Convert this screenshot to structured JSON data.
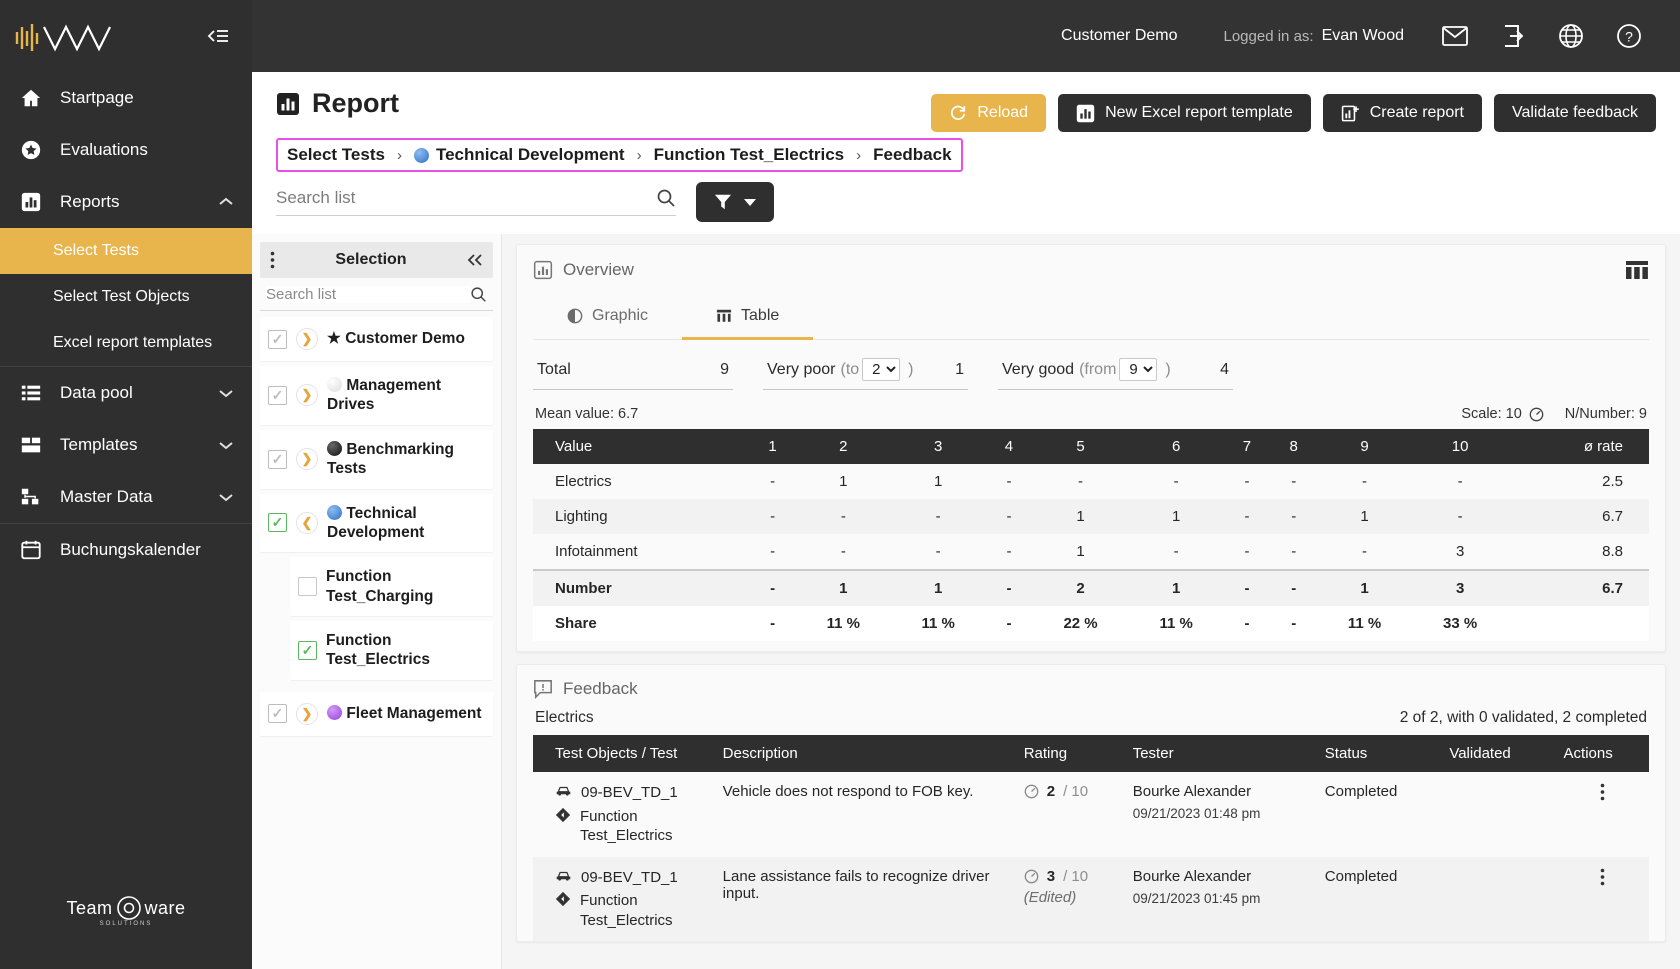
{
  "sidebar": {
    "logo_name": "teamware-wave-logo",
    "collapse_icon": "collapse-sidebar-icon",
    "items": [
      {
        "label": "Startpage",
        "icon": "home-icon",
        "chevron": ""
      },
      {
        "label": "Evaluations",
        "icon": "star-circle-icon",
        "chevron": ""
      },
      {
        "label": "Reports",
        "icon": "bar-chart-icon",
        "chevron": "chevron-up-icon"
      },
      {
        "label": "Data pool",
        "icon": "list-icon",
        "chevron": "chevron-down-icon"
      },
      {
        "label": "Templates",
        "icon": "layout-icon",
        "chevron": "chevron-down-icon"
      },
      {
        "label": "Master Data",
        "icon": "sitemap-icon",
        "chevron": "chevron-down-icon"
      },
      {
        "label": "Buchungskalender",
        "icon": "calendar-icon",
        "chevron": ""
      }
    ],
    "sub_items": [
      {
        "label": "Select Tests",
        "active": true
      },
      {
        "label": "Select Test Objects",
        "active": false
      },
      {
        "label": "Excel report templates",
        "active": false
      }
    ],
    "footer": {
      "brand_a": "Team",
      "brand_b": "ware",
      "brand_sub": "SOLUTIONS"
    }
  },
  "topbar": {
    "customer": "Customer Demo",
    "logged_label": "Logged in as:",
    "user": "Evan Wood",
    "icons": [
      "mail-icon",
      "logout-icon",
      "globe-icon",
      "help-icon"
    ]
  },
  "page": {
    "title": "Report",
    "title_icon": "report-chart-icon",
    "actions": [
      {
        "label": "Reload",
        "icon": "refresh-icon",
        "style": "amber"
      },
      {
        "label": "New Excel report template",
        "icon": "bar-chart-icon",
        "style": "dark"
      },
      {
        "label": "Create report",
        "icon": "chart-plus-icon",
        "style": "dark"
      },
      {
        "label": "Validate feedback",
        "icon": "",
        "style": "dark"
      }
    ]
  },
  "breadcrumb": {
    "items": [
      {
        "label": "Select Tests",
        "dot": ""
      },
      {
        "label": "Technical Development",
        "dot": "#3b7dd8"
      },
      {
        "label": "Function Test_Electrics",
        "dot": ""
      },
      {
        "label": "Feedback",
        "dot": ""
      }
    ],
    "separator": "›",
    "highlight_color": "#ea4fea"
  },
  "search": {
    "placeholder": "Search list",
    "value": "",
    "icon": "search-icon",
    "filter_icon": "filter-icon",
    "filter_caret": "caret-down-icon"
  },
  "selection": {
    "title": "Selection",
    "kebab_icon": "more-vertical-icon",
    "collapse_icon": "chevron-double-left-icon",
    "search_placeholder": "Search list",
    "search_value": "",
    "tree": [
      {
        "label": "Customer Demo",
        "checkbox": "indeterminate",
        "expander": "right",
        "marker": "star",
        "marker_color": "#111111",
        "child": false
      },
      {
        "label": "Management Drives",
        "checkbox": "indeterminate",
        "expander": "right",
        "marker": "dot",
        "marker_color": "#e2e2e2",
        "child": false
      },
      {
        "label": "Benchmarking Tests",
        "checkbox": "indeterminate",
        "expander": "right",
        "marker": "dot",
        "marker_color": "#1c1c1c",
        "child": false
      },
      {
        "label": "Technical Development",
        "checkbox": "checked",
        "expander": "down",
        "marker": "dot",
        "marker_color": "#3b7dd8",
        "child": false
      },
      {
        "label": "Function Test_Charging",
        "checkbox": "empty",
        "expander": "none",
        "marker": "none",
        "marker_color": "",
        "child": true
      },
      {
        "label": "Function Test_Electrics",
        "checkbox": "checked",
        "expander": "none",
        "marker": "none",
        "marker_color": "",
        "child": true
      },
      {
        "label": "Fleet Management",
        "checkbox": "indeterminate",
        "expander": "right",
        "marker": "dot",
        "marker_color": "#a855e8",
        "child": false
      }
    ]
  },
  "overview": {
    "title": "Overview",
    "title_icon": "bar-chart-icon",
    "grid_icon": "table-columns-icon",
    "tabs": [
      {
        "label": "Graphic",
        "icon": "pie-chart-icon",
        "active": false
      },
      {
        "label": "Table",
        "icon": "table-icon",
        "active": true
      }
    ],
    "stats": [
      {
        "label": "Total",
        "hint": "",
        "select": "",
        "value": "9"
      },
      {
        "label": "Very poor",
        "hint_open": "(to",
        "select": "2",
        "hint_close": ")",
        "value": "1"
      },
      {
        "label": "Very good",
        "hint_open": "(from",
        "select": "9",
        "hint_close": ")",
        "value": "4"
      }
    ],
    "mean_label": "Mean value: 6.7",
    "scale_label": "Scale: 10",
    "scale_icon": "gauge-icon",
    "nnumber_label": "N/Number: 9"
  },
  "chart_data": {
    "type": "table",
    "title": "Overview rating distribution",
    "first_col_header": "Value",
    "categories": [
      "1",
      "2",
      "3",
      "4",
      "5",
      "6",
      "7",
      "8",
      "9",
      "10"
    ],
    "last_col_header": "ø rate",
    "rows": [
      {
        "name": "Electrics",
        "values": [
          "-",
          "1",
          "1",
          "-",
          "-",
          "-",
          "-",
          "-",
          "-",
          "-"
        ],
        "avg": "2.5",
        "kind": "data"
      },
      {
        "name": "Lighting",
        "values": [
          "-",
          "-",
          "-",
          "-",
          "1",
          "1",
          "-",
          "-",
          "1",
          "-"
        ],
        "avg": "6.7",
        "kind": "data"
      },
      {
        "name": "Infotainment",
        "values": [
          "-",
          "-",
          "-",
          "-",
          "1",
          "-",
          "-",
          "-",
          "-",
          "3"
        ],
        "avg": "8.8",
        "kind": "data"
      },
      {
        "name": "Number",
        "values": [
          "-",
          "1",
          "1",
          "-",
          "2",
          "1",
          "-",
          "-",
          "1",
          "3"
        ],
        "avg": "6.7",
        "kind": "sum"
      },
      {
        "name": "Share",
        "values": [
          "-",
          "11 %",
          "11 %",
          "-",
          "22 %",
          "11 %",
          "-",
          "-",
          "11 %",
          "33 %"
        ],
        "avg": "",
        "kind": "share"
      }
    ],
    "mean_value": 6.7,
    "scale_max": 10,
    "n_number": 9,
    "total": 9,
    "very_poor_count": 1,
    "very_good_count": 4
  },
  "feedback": {
    "title": "Feedback",
    "title_icon": "comment-alert-icon",
    "group_label": "Electrics",
    "summary": "2 of 2, with 0 validated, 2 completed",
    "columns": [
      "Test Objects / Test",
      "Description",
      "Rating",
      "Tester",
      "Status",
      "Validated",
      "Actions"
    ],
    "rows": [
      {
        "object": "09-BEV_TD_1",
        "object_icon": "car-icon",
        "test": "Function Test_Electrics",
        "test_icon": "diamond-arrow-icon",
        "description": "Vehicle does not respond to FOB key.",
        "edited": "",
        "rating_icon": "gauge-icon",
        "rating_value": "2",
        "rating_scale": "/ 10",
        "tester": "Bourke Alexander",
        "tester_date": "09/21/2023 01:48 pm",
        "status": "Completed",
        "validated": "",
        "actions_icon": "more-vertical-icon"
      },
      {
        "object": "09-BEV_TD_1",
        "object_icon": "car-icon",
        "test": "Function Test_Electrics",
        "test_icon": "diamond-arrow-icon",
        "description": "Lane assistance fails to recognize driver input.",
        "edited": "(Edited)",
        "rating_icon": "gauge-icon",
        "rating_value": "3",
        "rating_scale": "/ 10",
        "tester": "Bourke Alexander",
        "tester_date": "09/21/2023 01:45 pm",
        "status": "Completed",
        "validated": "",
        "actions_icon": "more-vertical-icon"
      }
    ]
  },
  "colors": {
    "accent": "#e8b44c",
    "dark": "#2f2f2f",
    "highlight": "#ea4fea",
    "green": "#5cb85c"
  }
}
